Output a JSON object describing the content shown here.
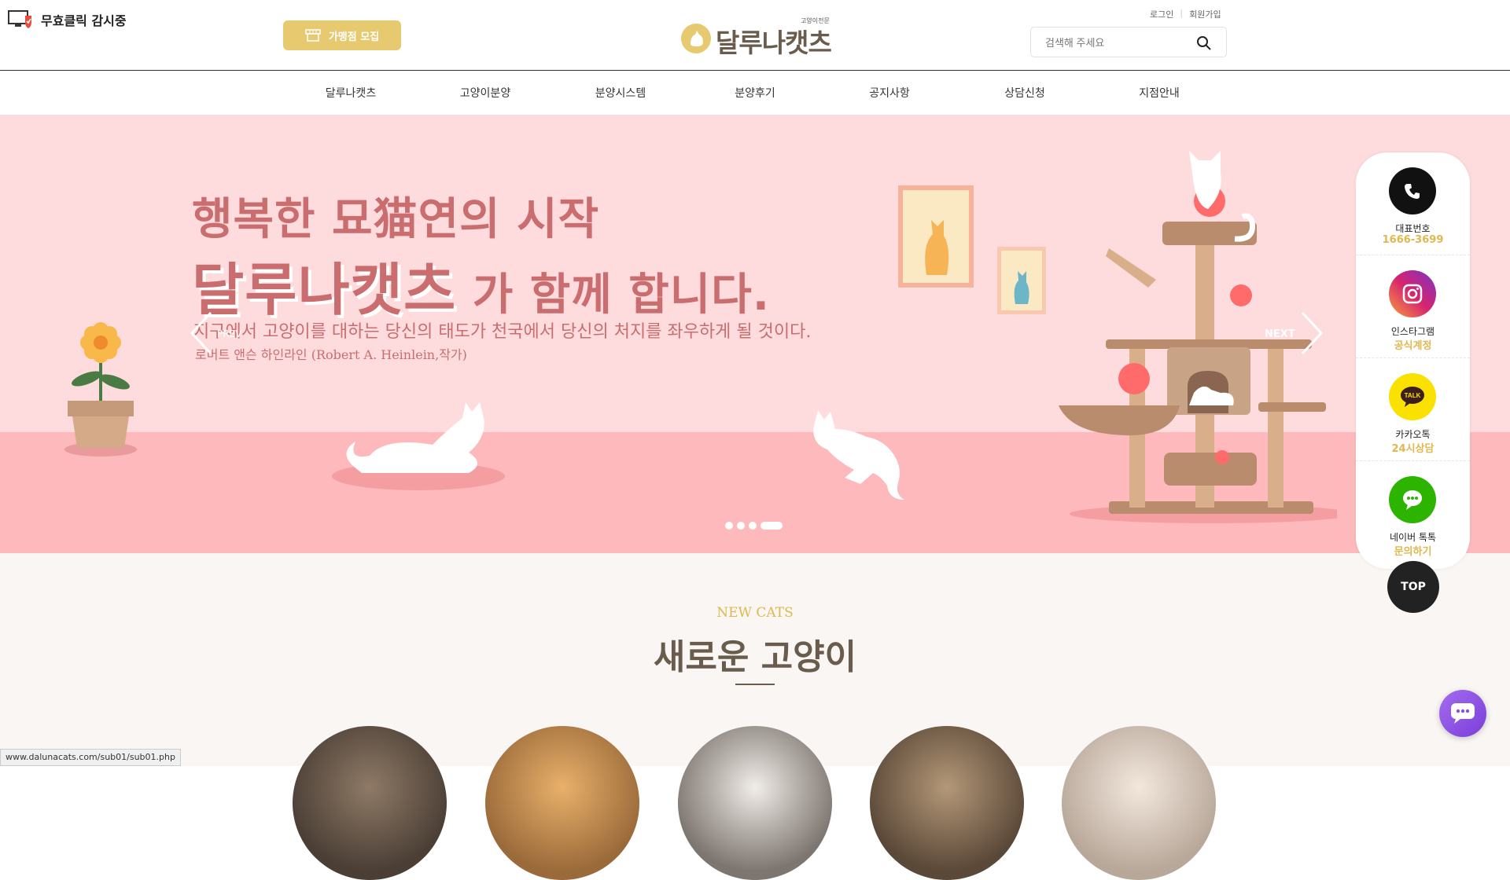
{
  "header": {
    "monitor_badge": "무효클릭 감시중",
    "franchise_button": "가맹점 모집",
    "logo_subtitle": "고양이전문",
    "logo_text": "달루나캣츠",
    "login": "로그인",
    "signup": "회원가입",
    "search_placeholder": "검색해 주세요"
  },
  "nav": {
    "items": [
      "달루나캣츠",
      "고양이분양",
      "분양시스템",
      "분양후기",
      "공지사항",
      "상담신청",
      "지점안내"
    ]
  },
  "hero": {
    "line1": "행복한 묘猫연의 시작",
    "line2_brand": "달루나캣츠",
    "line2_rest": " 가 함께 합니다.",
    "quote": "지구에서 고양이를 대하는 당신의 태도가 천국에서 당신의 처지를 좌우하게 될 것이다.",
    "author": "로버트 앤슨 하인라인 (Robert A. Heinlein,작가)",
    "prev_label": "PREV",
    "next_label": "NEXT",
    "slide_count": 4,
    "active_slide": 4
  },
  "side_panel": {
    "items": [
      {
        "label": "대표번호",
        "sub": "1666-3699",
        "icon": "phone-icon",
        "color": "#111111"
      },
      {
        "label": "인스타그램",
        "sub": "공식계정",
        "icon": "instagram-icon",
        "color": "#c13584"
      },
      {
        "label": "카카오톡",
        "sub": "24시상담",
        "icon": "kakaotalk-icon",
        "color": "#fae100"
      },
      {
        "label": "네이버 톡톡",
        "sub": "문의하기",
        "icon": "naver-talk-icon",
        "color": "#2db400"
      }
    ],
    "top_button": "TOP"
  },
  "section": {
    "subtitle": "NEW CATS",
    "title": "새로운 고양이"
  },
  "status_bar": "www.dalunacats.com/sub01/sub01.php",
  "colors": {
    "accent_gold": "#e7c96f",
    "brand_brown": "#6a5c4d",
    "hero_pink": "#fedcdd",
    "hero_text": "#c96d6f"
  }
}
